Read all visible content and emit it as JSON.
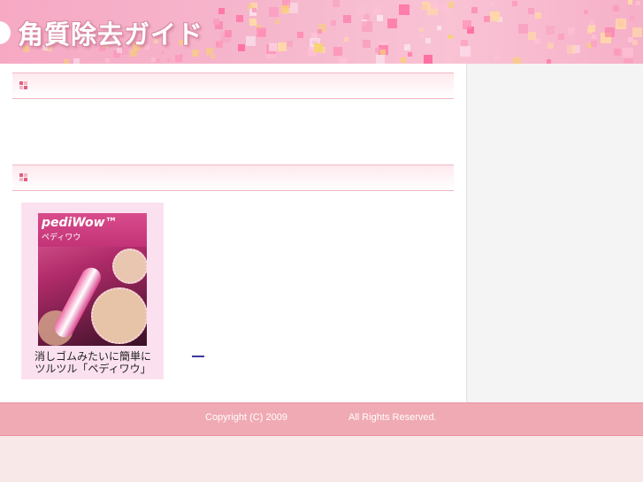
{
  "header": {
    "site_title": "角質除去ガイド"
  },
  "product": {
    "logo": "pediWow™",
    "logo_kana": "ペディワウ",
    "caption_line1": "消しゴムみたいに簡単に",
    "caption_line2": "ツルツル「ペディワウ」"
  },
  "footer": {
    "copyright": "Copyright (C) 2009",
    "rights": "All Rights Reserved."
  },
  "colors": {
    "header_pink": "#f7a9c4",
    "footer_pink": "#f0aab3",
    "section_border": "#f2b7c3",
    "mark_dark": "#e0607e",
    "mark_light": "#f5b4c3"
  }
}
